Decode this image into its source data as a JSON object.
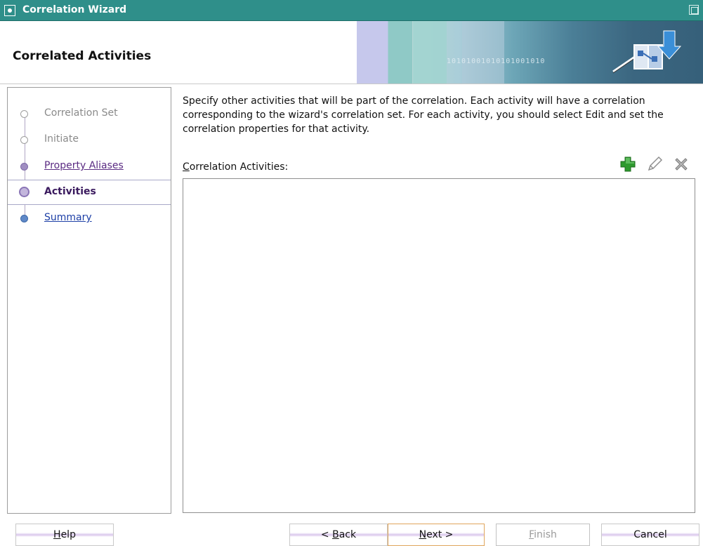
{
  "window": {
    "title": "Correlation Wizard"
  },
  "header": {
    "title": "Correlated Activities",
    "banner_bits": "10101001010101001010"
  },
  "nav": {
    "steps": [
      {
        "label": "Correlation Set",
        "state": "done"
      },
      {
        "label": "Initiate",
        "state": "done"
      },
      {
        "label": "Property Aliases",
        "state": "link"
      },
      {
        "label": "Activities",
        "state": "current"
      },
      {
        "label": "Summary",
        "state": "future"
      }
    ]
  },
  "content": {
    "description": "Specify other activities that will be part of the correlation. Each activity will have a correlation corresponding to the wizard's correlation set. For each activity, you should select Edit and set the correlation properties for that activity.",
    "list_label_mnemonic": "C",
    "list_label_rest": "orrelation Activities:",
    "toolbar": {
      "add_icon": "add-icon",
      "edit_icon": "edit-icon",
      "remove_icon": "remove-icon"
    },
    "activities": []
  },
  "buttons": {
    "help": {
      "mnemonic": "H",
      "rest": "elp"
    },
    "back": {
      "prefix": "< ",
      "mnemonic": "B",
      "rest": "ack"
    },
    "next": {
      "mnemonic": "N",
      "rest": "ext >"
    },
    "finish": {
      "mnemonic": "F",
      "rest": "inish"
    },
    "cancel": {
      "label": "Cancel"
    }
  },
  "colors": {
    "titlebar": "#2f8f8a",
    "link": "#5b2c83",
    "future_link": "#1d3fa6",
    "add_icon": "#2e9a2e"
  }
}
